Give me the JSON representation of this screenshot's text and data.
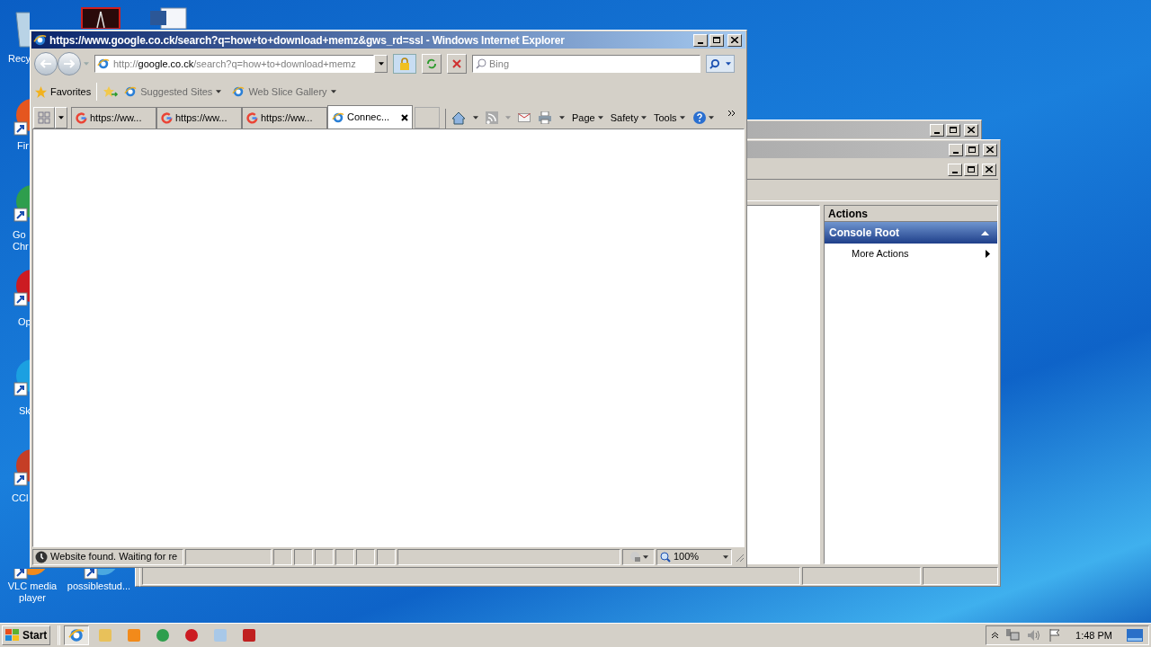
{
  "desktop": {
    "icons": [
      {
        "kind": "bin",
        "lines": [
          "Recy"
        ]
      },
      {
        "kind": "fox",
        "lines": [
          "Fir"
        ]
      },
      {
        "kind": "chrome",
        "lines": [
          "Go",
          "Chr"
        ]
      },
      {
        "kind": "opera",
        "lines": [
          "Op"
        ]
      },
      {
        "kind": "skype",
        "lines": [
          "Sk"
        ]
      },
      {
        "kind": "ccleaner",
        "lines": [
          "CCl"
        ]
      },
      {
        "kind": "vlc",
        "lines": [
          "VLC media",
          "player"
        ]
      },
      {
        "kind": "file",
        "lines": [
          "possiblestud..."
        ]
      },
      {
        "kind": "pdf"
      },
      {
        "kind": "word"
      }
    ]
  },
  "console": {
    "actions_title": "Actions",
    "section": "Console Root",
    "items": [
      "More Actions"
    ]
  },
  "browser": {
    "title": "https://www.google.co.ck/search?q=how+to+download+memz&gws_rd=ssl - Windows Internet Explorer",
    "address": {
      "scheme": "http://",
      "domain": "google.co.ck",
      "path": "/search?q=how+to+download+memz"
    },
    "search_placeholder": "Bing",
    "favorites": {
      "label": "Favorites",
      "items": [
        "Suggested Sites",
        "Web Slice Gallery"
      ]
    },
    "tabs": [
      {
        "kind": "google",
        "label": "https://ww...",
        "selected": false
      },
      {
        "kind": "google",
        "label": "https://ww...",
        "selected": false
      },
      {
        "kind": "google",
        "label": "https://ww...",
        "selected": false
      },
      {
        "kind": "ie",
        "label": "Connec...",
        "selected": true
      }
    ],
    "menus": [
      "Page",
      "Safety",
      "Tools"
    ],
    "status": "Website found. Waiting for re",
    "zoom": "100%"
  },
  "taskbar": {
    "start": "Start",
    "apps": [
      {
        "kind": "ie",
        "selected": true
      },
      {
        "kind": "folder",
        "selected": false
      },
      {
        "kind": "player",
        "selected": false
      },
      {
        "kind": "chrome",
        "selected": false
      },
      {
        "kind": "opera",
        "selected": false
      },
      {
        "kind": "notepad",
        "selected": false
      },
      {
        "kind": "toolbox",
        "selected": false
      }
    ],
    "clock": "1:48 PM"
  }
}
